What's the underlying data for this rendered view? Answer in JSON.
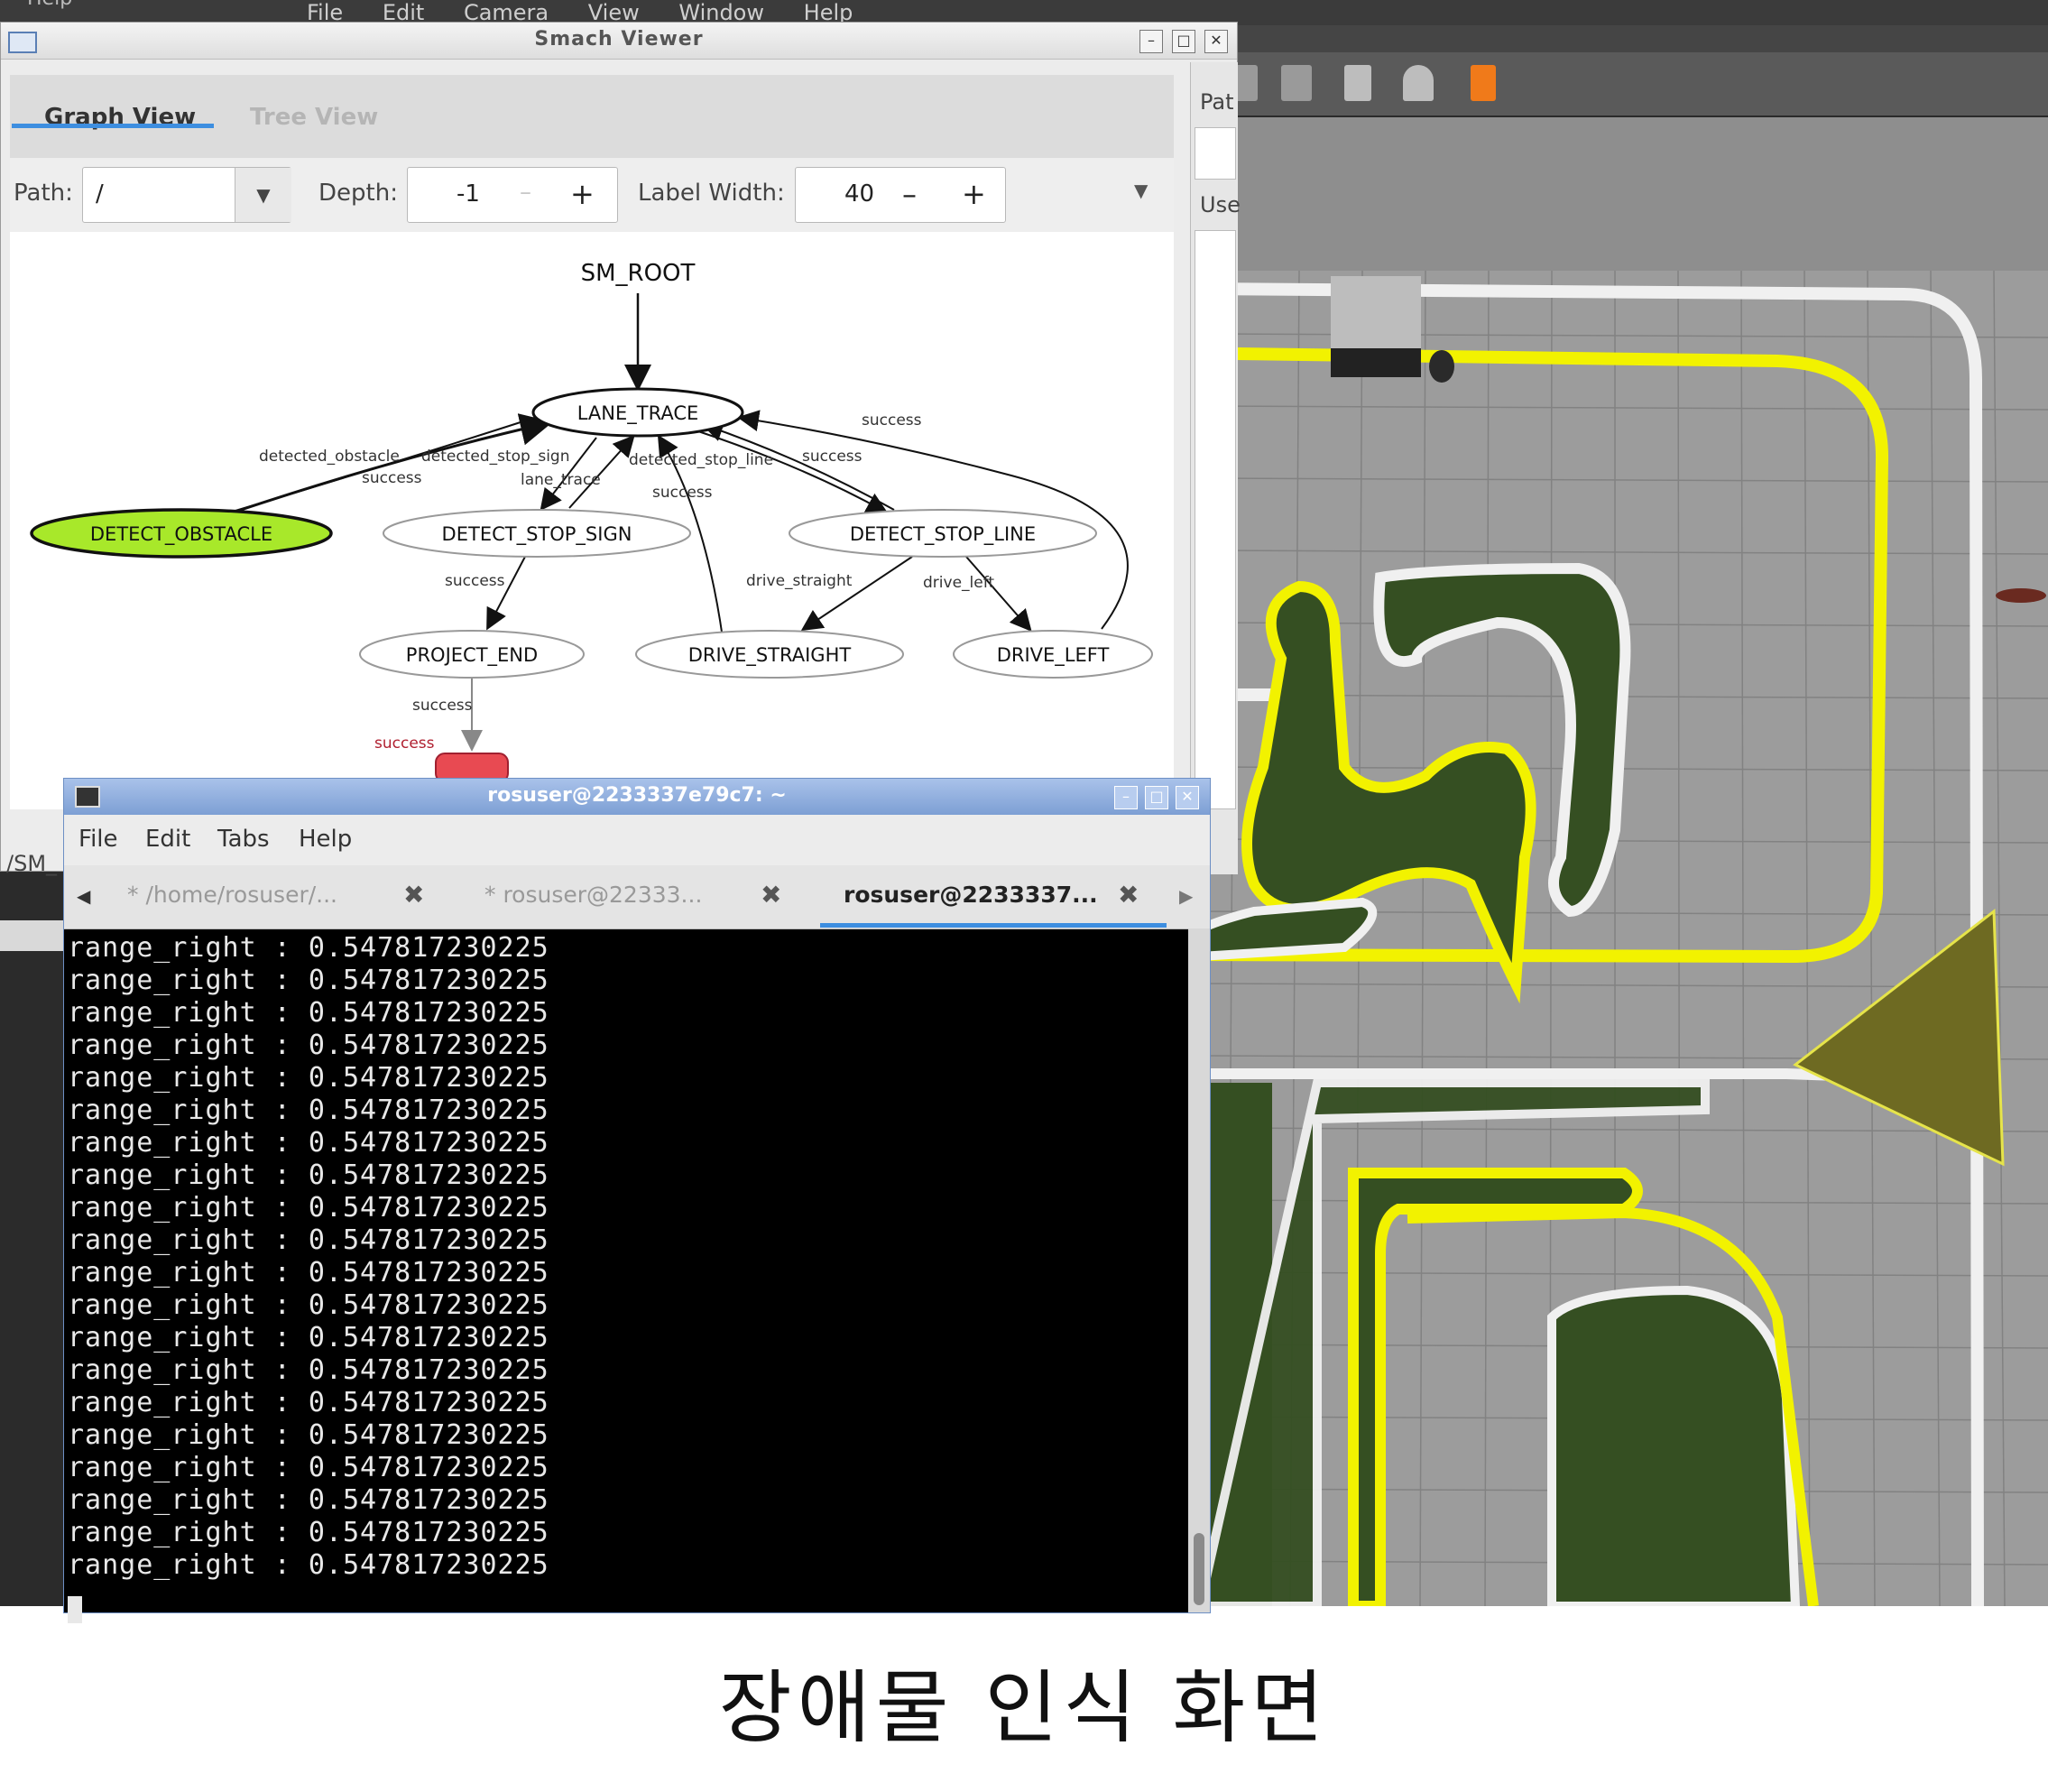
{
  "background_menu": {
    "items": [
      "File",
      "Edit",
      "Camera",
      "View",
      "Window",
      "Help"
    ],
    "help_fragment": "Help"
  },
  "smach": {
    "title": "Smach Viewer",
    "tabs": [
      "Graph View",
      "Tree View"
    ],
    "path_label": "Path:",
    "path_value": "/",
    "depth_label": "Depth:",
    "depth_value": "-1",
    "label_width_label": "Label Width:",
    "label_width_value": "40",
    "right_panel": {
      "path_label": "Pat",
      "user_label": "Use"
    },
    "sm_label": "/SM_",
    "graph": {
      "root": "SM_ROOT",
      "states": [
        "LANE_TRACE",
        "DETECT_OBSTACLE",
        "DETECT_STOP_SIGN",
        "DETECT_STOP_LINE",
        "PROJECT_END",
        "DRIVE_STRAIGHT",
        "DRIVE_LEFT"
      ],
      "edge_labels": [
        "detected_obstacle",
        "detected_stop_sign",
        "success",
        "lane_trace",
        "detected_stop_line",
        "success",
        "success",
        "success",
        "success",
        "drive_straight",
        "drive_left",
        "success"
      ],
      "outcome_label": "success",
      "active_state": "DETECT_OBSTACLE",
      "active_color": "#a8e82a",
      "outcome_color": "#e84a52"
    }
  },
  "terminal": {
    "title": "rosuser@2233337e79c7: ~",
    "menu": [
      "File",
      "Edit",
      "Tabs",
      "Help"
    ],
    "tabs": [
      "* /home/rosuser/...",
      "* rosuser@22333...",
      "rosuser@2233337..."
    ],
    "active_tab": 2,
    "lines": [
      "range_right : 0.547817230225",
      "range_right : 0.547817230225",
      "range_right : 0.547817230225",
      "range_right : 0.547817230225",
      "range_right : 0.547817230225",
      "range_right : 0.547817230225",
      "range_right : 0.547817230225",
      "range_right : 0.547817230225",
      "range_right : 0.547817230225",
      "range_right : 0.547817230225",
      "range_right : 0.547817230225",
      "range_right : 0.547817230225",
      "range_right : 0.547817230225",
      "range_right : 0.547817230225",
      "range_right : 0.547817230225",
      "range_right : 0.547817230225",
      "range_right : 0.547817230225",
      "range_right : 0.547817230225",
      "range_right : 0.547817230225",
      "range_right : 0.547817230225"
    ]
  },
  "caption": "장애물 인식 화면",
  "colors": {
    "lane_yellow": "#f2f200",
    "grass": "#354f22",
    "track_gray": "#9a9a9a",
    "line_white": "#f0f0f0"
  }
}
